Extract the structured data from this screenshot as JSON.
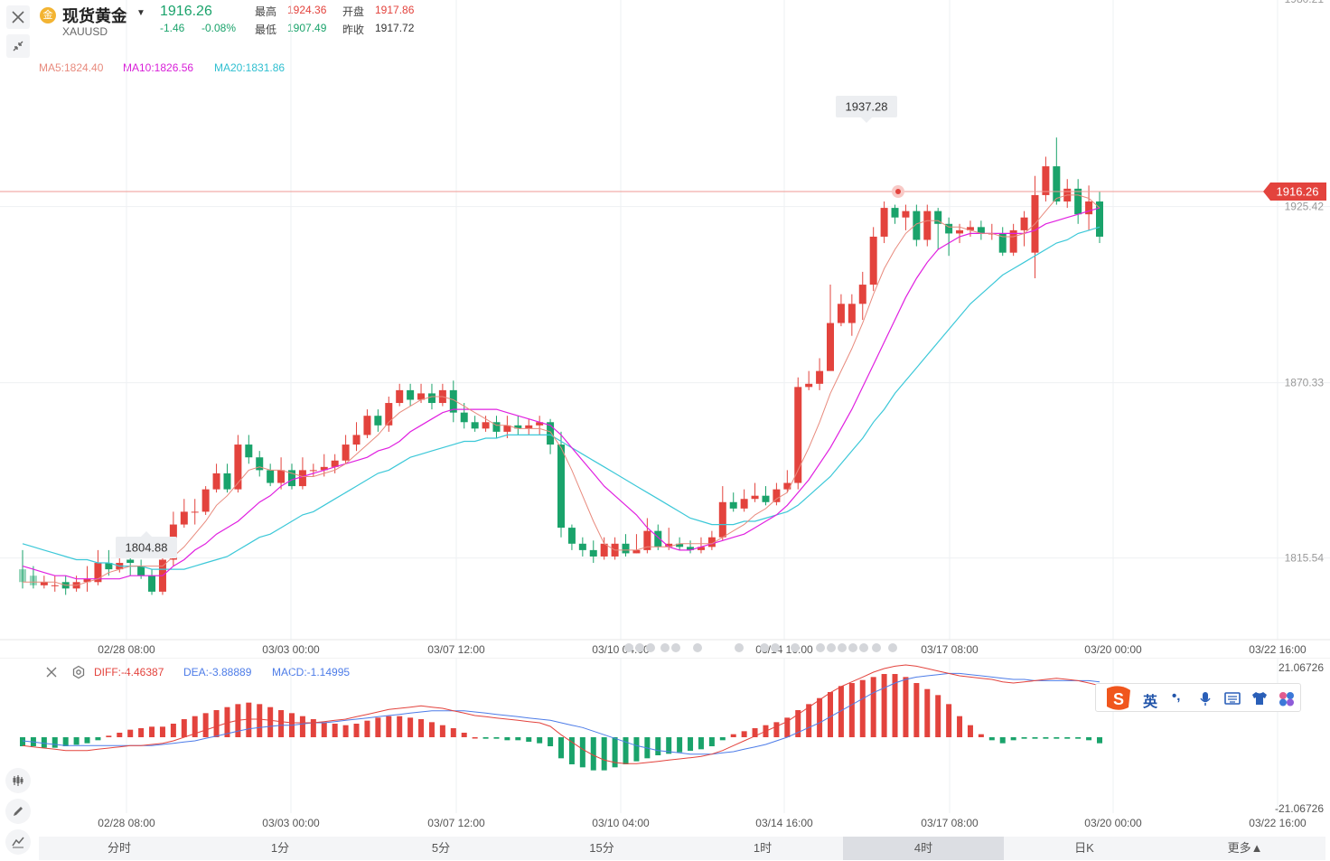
{
  "header": {
    "name": "现货黄金",
    "symbol": "XAUUSD",
    "price": "1916.26",
    "change": "-1.46",
    "change_pct": "-0.08%",
    "high_label": "最高",
    "high": "1924.36",
    "open_label": "开盘",
    "open": "1917.86",
    "low_label": "最低",
    "low": "1907.49",
    "prev_label": "昨收",
    "prev": "1917.72"
  },
  "ma_legend": {
    "ma5": "MA5:1824.40",
    "ma10": "MA10:1826.56",
    "ma20": "MA20:1831.86"
  },
  "price_axis": {
    "top_partial": "1980.21",
    "labels": [
      "1925.42",
      "1870.33",
      "1815.54"
    ],
    "current": "1916.26"
  },
  "annotations": {
    "max": "1937.28",
    "min": "1804.88"
  },
  "time_axis": [
    "02/28 08:00",
    "03/03 00:00",
    "03/07 12:00",
    "03/10 04:00",
    "03/14 16:00",
    "03/17 08:00",
    "03/20 00:00",
    "03/22 16:00"
  ],
  "macd": {
    "diff": "DIFF:-4.46387",
    "dea": "DEA:-3.88889",
    "macd": "MACD:-1.14995",
    "axis_top": "21.06726",
    "axis_bottom": "-21.06726"
  },
  "ime": {
    "lang": "英",
    "punct": "•,"
  },
  "period_tabs": [
    "分时",
    "1分",
    "5分",
    "15分",
    "1时",
    "4时",
    "日K",
    "更多▲"
  ],
  "active_tab": "4时",
  "colors": {
    "up": "#e3433d",
    "down": "#1aa36b",
    "ma5": "#e88a7d",
    "ma10": "#e020e0",
    "ma20": "#3cc8d8",
    "diff": "#e3433d",
    "dea": "#4d7ce8"
  },
  "chart_data": {
    "type": "candlestick",
    "ylim": [
      1790,
      1990
    ],
    "candles": [
      [
        1812,
        1808,
        1818,
        1806
      ],
      [
        1810,
        1807,
        1813,
        1806
      ],
      [
        1807,
        1808,
        1810,
        1806
      ],
      [
        1807,
        1807,
        1810,
        1805
      ],
      [
        1808,
        1806,
        1810,
        1804
      ],
      [
        1806,
        1808,
        1810,
        1805
      ],
      [
        1808,
        1809,
        1813,
        1805
      ],
      [
        1808,
        1814,
        1818,
        1807
      ],
      [
        1814,
        1812,
        1818,
        1810
      ],
      [
        1812,
        1814,
        1816,
        1811
      ],
      [
        1815,
        1814,
        1818,
        1810
      ],
      [
        1813,
        1810,
        1815,
        1809
      ],
      [
        1810,
        1805,
        1812,
        1804
      ],
      [
        1805,
        1815,
        1818,
        1804
      ],
      [
        1815,
        1826,
        1830,
        1813
      ],
      [
        1826,
        1830,
        1834,
        1825
      ],
      [
        1830,
        1830,
        1834,
        1826
      ],
      [
        1830,
        1837,
        1838,
        1829
      ],
      [
        1837,
        1842,
        1845,
        1836
      ],
      [
        1842,
        1837,
        1845,
        1836
      ],
      [
        1837,
        1851,
        1854,
        1836
      ],
      [
        1851,
        1847,
        1854,
        1845
      ],
      [
        1847,
        1843,
        1849,
        1841
      ],
      [
        1843,
        1839,
        1845,
        1838
      ],
      [
        1839,
        1843,
        1847,
        1837
      ],
      [
        1843,
        1838,
        1845,
        1837
      ],
      [
        1838,
        1843,
        1847,
        1837
      ],
      [
        1843,
        1843,
        1845,
        1841
      ],
      [
        1843,
        1844,
        1848,
        1841
      ],
      [
        1844,
        1846,
        1848,
        1842
      ],
      [
        1846,
        1851,
        1854,
        1845
      ],
      [
        1851,
        1854,
        1858,
        1849
      ],
      [
        1854,
        1860,
        1862,
        1853
      ],
      [
        1860,
        1857,
        1862,
        1855
      ],
      [
        1857,
        1864,
        1866,
        1855
      ],
      [
        1864,
        1868,
        1870,
        1863
      ],
      [
        1868,
        1865,
        1870,
        1863
      ],
      [
        1865,
        1867,
        1870,
        1864
      ],
      [
        1867,
        1864,
        1870,
        1862
      ],
      [
        1864,
        1868,
        1870,
        1863
      ],
      [
        1868,
        1861,
        1871,
        1858
      ],
      [
        1861,
        1858,
        1864,
        1856
      ],
      [
        1858,
        1856,
        1860,
        1855
      ],
      [
        1856,
        1858,
        1860,
        1855
      ],
      [
        1858,
        1855,
        1860,
        1853
      ],
      [
        1855,
        1857,
        1860,
        1853
      ],
      [
        1857,
        1856,
        1860,
        1854
      ],
      [
        1856,
        1857,
        1859,
        1854
      ],
      [
        1857,
        1858,
        1860,
        1854
      ],
      [
        1858,
        1851,
        1859,
        1848
      ],
      [
        1851,
        1825,
        1855,
        1822
      ],
      [
        1825,
        1820,
        1826,
        1818
      ],
      [
        1820,
        1818,
        1822,
        1816
      ],
      [
        1818,
        1816,
        1821,
        1814
      ],
      [
        1816,
        1820,
        1822,
        1815
      ],
      [
        1816,
        1820,
        1822,
        1815
      ],
      [
        1820,
        1817,
        1823,
        1816
      ],
      [
        1817,
        1818,
        1823,
        1817
      ],
      [
        1818,
        1824,
        1828,
        1817
      ],
      [
        1824,
        1819,
        1826,
        1818
      ],
      [
        1819,
        1820,
        1825,
        1818
      ],
      [
        1820,
        1819,
        1822,
        1818
      ],
      [
        1819,
        1818,
        1821,
        1817
      ],
      [
        1818,
        1819,
        1822,
        1817
      ],
      [
        1819,
        1822,
        1824,
        1818
      ],
      [
        1822,
        1833,
        1838,
        1821
      ],
      [
        1833,
        1831,
        1836,
        1830
      ],
      [
        1831,
        1834,
        1837,
        1830
      ],
      [
        1834,
        1835,
        1839,
        1833
      ],
      [
        1835,
        1833,
        1838,
        1832
      ],
      [
        1833,
        1837,
        1839,
        1832
      ],
      [
        1837,
        1839,
        1843,
        1836
      ],
      [
        1839,
        1869,
        1872,
        1837
      ],
      [
        1869,
        1870,
        1874,
        1868
      ],
      [
        1870,
        1874,
        1878,
        1868
      ],
      [
        1874,
        1889,
        1901,
        1887
      ],
      [
        1889,
        1895,
        1898,
        1888
      ],
      [
        1889,
        1895,
        1898,
        1885
      ],
      [
        1895,
        1901,
        1905,
        1890
      ],
      [
        1901,
        1916,
        1919,
        1899
      ],
      [
        1916,
        1925,
        1927,
        1914
      ],
      [
        1925,
        1922,
        1926,
        1920
      ],
      [
        1922,
        1924,
        1926,
        1918
      ],
      [
        1924,
        1915,
        1926,
        1913
      ],
      [
        1915,
        1924,
        1926,
        1913
      ],
      [
        1924,
        1920,
        1925,
        1912
      ],
      [
        1920,
        1917,
        1922,
        1910
      ],
      [
        1917,
        1918,
        1920,
        1914
      ],
      [
        1918,
        1919,
        1921,
        1916
      ],
      [
        1919,
        1917,
        1921,
        1915
      ],
      [
        1917,
        1917,
        1920,
        1915
      ],
      [
        1917,
        1911,
        1919,
        1910
      ],
      [
        1911,
        1918,
        1920,
        1910
      ],
      [
        1918,
        1922,
        1924,
        1913
      ],
      [
        1911,
        1929,
        1935,
        1903
      ],
      [
        1929,
        1938,
        1941,
        1927
      ],
      [
        1938,
        1927,
        1947,
        1926
      ],
      [
        1927,
        1931,
        1934,
        1925
      ],
      [
        1931,
        1923,
        1934,
        1920
      ],
      [
        1923,
        1927,
        1932,
        1918
      ],
      [
        1927,
        1916,
        1930,
        1914
      ]
    ],
    "ma5": [
      1808,
      1808,
      1808,
      1808,
      1807,
      1807,
      1808,
      1809,
      1811,
      1812,
      1813,
      1813,
      1813,
      1813,
      1816,
      1819,
      1823,
      1827,
      1832,
      1835,
      1839,
      1843,
      1844,
      1843,
      1843,
      1842,
      1841,
      1841,
      1842,
      1843,
      1845,
      1848,
      1851,
      1854,
      1858,
      1861,
      1863,
      1865,
      1866,
      1866,
      1865,
      1863,
      1861,
      1859,
      1857,
      1857,
      1856,
      1856,
      1856,
      1855,
      1850,
      1843,
      1835,
      1827,
      1820,
      1818,
      1818,
      1818,
      1819,
      1819,
      1819,
      1820,
      1820,
      1820,
      1820,
      1822,
      1824,
      1826,
      1829,
      1831,
      1834,
      1836,
      1843,
      1850,
      1858,
      1867,
      1874,
      1881,
      1889,
      1898,
      1906,
      1912,
      1917,
      1920,
      1921,
      1921,
      1919,
      1919,
      1918,
      1917,
      1917,
      1916,
      1916,
      1917,
      1920,
      1924,
      1928,
      1929,
      1929,
      1928,
      1925
    ],
    "ma10": [
      1813,
      1812,
      1811,
      1810,
      1810,
      1809,
      1809,
      1809,
      1809,
      1809,
      1810,
      1810,
      1810,
      1810,
      1813,
      1815,
      1818,
      1820,
      1823,
      1825,
      1827,
      1830,
      1833,
      1835,
      1838,
      1840,
      1841,
      1842,
      1843,
      1844,
      1845,
      1846,
      1847,
      1849,
      1850,
      1852,
      1855,
      1857,
      1859,
      1861,
      1862,
      1862,
      1862,
      1862,
      1862,
      1861,
      1860,
      1859,
      1858,
      1857,
      1854,
      1850,
      1846,
      1842,
      1838,
      1835,
      1832,
      1829,
      1825,
      1822,
      1819,
      1818,
      1818,
      1819,
      1820,
      1821,
      1822,
      1823,
      1825,
      1827,
      1829,
      1832,
      1836,
      1840,
      1845,
      1850,
      1856,
      1862,
      1869,
      1876,
      1883,
      1890,
      1897,
      1903,
      1908,
      1912,
      1914,
      1916,
      1917,
      1917,
      1917,
      1917,
      1917,
      1917,
      1918,
      1920,
      1921,
      1922,
      1923,
      1924,
      1925
    ],
    "ma20": [
      1820,
      1819,
      1818,
      1817,
      1816,
      1815,
      1815,
      1814,
      1814,
      1813,
      1813,
      1813,
      1812,
      1812,
      1812,
      1812,
      1813,
      1814,
      1815,
      1816,
      1818,
      1820,
      1822,
      1823,
      1825,
      1827,
      1829,
      1830,
      1832,
      1834,
      1836,
      1838,
      1840,
      1842,
      1843,
      1845,
      1847,
      1848,
      1849,
      1850,
      1851,
      1852,
      1852,
      1853,
      1853,
      1854,
      1854,
      1854,
      1854,
      1854,
      1852,
      1850,
      1848,
      1846,
      1844,
      1842,
      1840,
      1838,
      1836,
      1834,
      1832,
      1830,
      1828,
      1827,
      1826,
      1826,
      1826,
      1827,
      1827,
      1828,
      1829,
      1830,
      1832,
      1835,
      1838,
      1841,
      1845,
      1849,
      1853,
      1858,
      1862,
      1867,
      1871,
      1875,
      1879,
      1883,
      1887,
      1891,
      1895,
      1898,
      1901,
      1904,
      1906,
      1908,
      1910,
      1912,
      1914,
      1915,
      1917,
      1918,
      1919
    ],
    "macd_ylim": [
      -21.06726,
      21.06726
    ],
    "macd_hist": [
      -3,
      -3,
      -3.5,
      -3.5,
      -3,
      -2.5,
      -2,
      -1,
      0.5,
      1.5,
      2.5,
      3,
      3.5,
      3.5,
      4.5,
      6,
      7,
      8,
      9,
      10,
      11,
      11.5,
      11,
      10,
      9,
      8,
      7,
      6,
      5,
      4.5,
      4,
      4.5,
      5.5,
      6.5,
      7,
      7,
      6.5,
      6,
      5,
      4,
      3,
      1.5,
      0,
      -0.5,
      -0.5,
      -1,
      -1,
      -1.5,
      -2,
      -3,
      -7,
      -9,
      -10,
      -11,
      -11,
      -10,
      -9,
      -8,
      -7,
      -6,
      -5.5,
      -5,
      -4.5,
      -4,
      -3,
      -1,
      1,
      2,
      3,
      4,
      5,
      6.5,
      9,
      11,
      13,
      15,
      17,
      18,
      19,
      20,
      21,
      21,
      20,
      18,
      16,
      14,
      11,
      7,
      4,
      1,
      -1,
      -2,
      -1,
      -0.5,
      -0.5,
      -0.5,
      -0.5,
      -0.5,
      -0.5,
      -1,
      -2
    ],
    "macd_diff": [
      -3.5,
      -4,
      -4.5,
      -5,
      -5.5,
      -5.5,
      -5.5,
      -5,
      -4.5,
      -4,
      -3.5,
      -3.5,
      -3,
      -2.5,
      -1.5,
      0,
      1.5,
      3,
      4.5,
      6,
      7,
      7.5,
      7.5,
      7,
      6.5,
      6,
      6,
      6,
      6.5,
      7,
      7.5,
      8.5,
      9.5,
      10.5,
      11.5,
      12,
      12.5,
      13,
      12.5,
      12,
      11,
      10,
      9,
      8.5,
      8,
      7.5,
      7,
      6.5,
      6,
      4.5,
      1,
      -2,
      -5,
      -7.5,
      -9.5,
      -10.5,
      -11,
      -11,
      -10.5,
      -10,
      -9.5,
      -9,
      -8.5,
      -8,
      -7,
      -5.5,
      -3.5,
      -1.5,
      0.5,
      2.5,
      4.5,
      6.5,
      9.5,
      12.5,
      15.5,
      18.5,
      21,
      23,
      25,
      27,
      28.5,
      29.5,
      30,
      29.5,
      28.5,
      27.5,
      26.5,
      25.5,
      25,
      24.5,
      24,
      23,
      22.5,
      23,
      23.5,
      24,
      24.5,
      24,
      23.5,
      22.5,
      21.5
    ],
    "macd_dea": [
      -1.5,
      -2,
      -2.5,
      -3,
      -3.5,
      -3.5,
      -3.5,
      -3.5,
      -3.5,
      -3.5,
      -3.5,
      -3.5,
      -3.5,
      -3,
      -2.5,
      -2,
      -1.5,
      -0.5,
      0.5,
      1.5,
      2.5,
      3.5,
      4,
      4.5,
      5,
      5,
      5.5,
      6,
      6,
      6.5,
      7,
      7.5,
      8,
      8.5,
      9,
      9.5,
      10,
      10.5,
      11,
      11,
      11,
      11,
      10.5,
      10,
      9.5,
      9,
      8.5,
      8,
      7.5,
      7,
      6,
      5,
      4,
      2.5,
      1,
      -0.5,
      -2,
      -3.5,
      -4.5,
      -5.5,
      -6,
      -6.5,
      -7,
      -7,
      -7,
      -6.5,
      -6,
      -5,
      -4,
      -3,
      -1.5,
      0,
      2,
      4,
      6,
      8.5,
      11,
      13.5,
      16,
      18.5,
      20.5,
      22.5,
      24,
      25,
      25.5,
      26,
      26.5,
      26.5,
      26,
      25.5,
      25,
      24.5,
      24,
      24,
      23.5,
      23.5,
      23.5,
      23.5,
      23.5,
      23.5,
      23
    ]
  }
}
